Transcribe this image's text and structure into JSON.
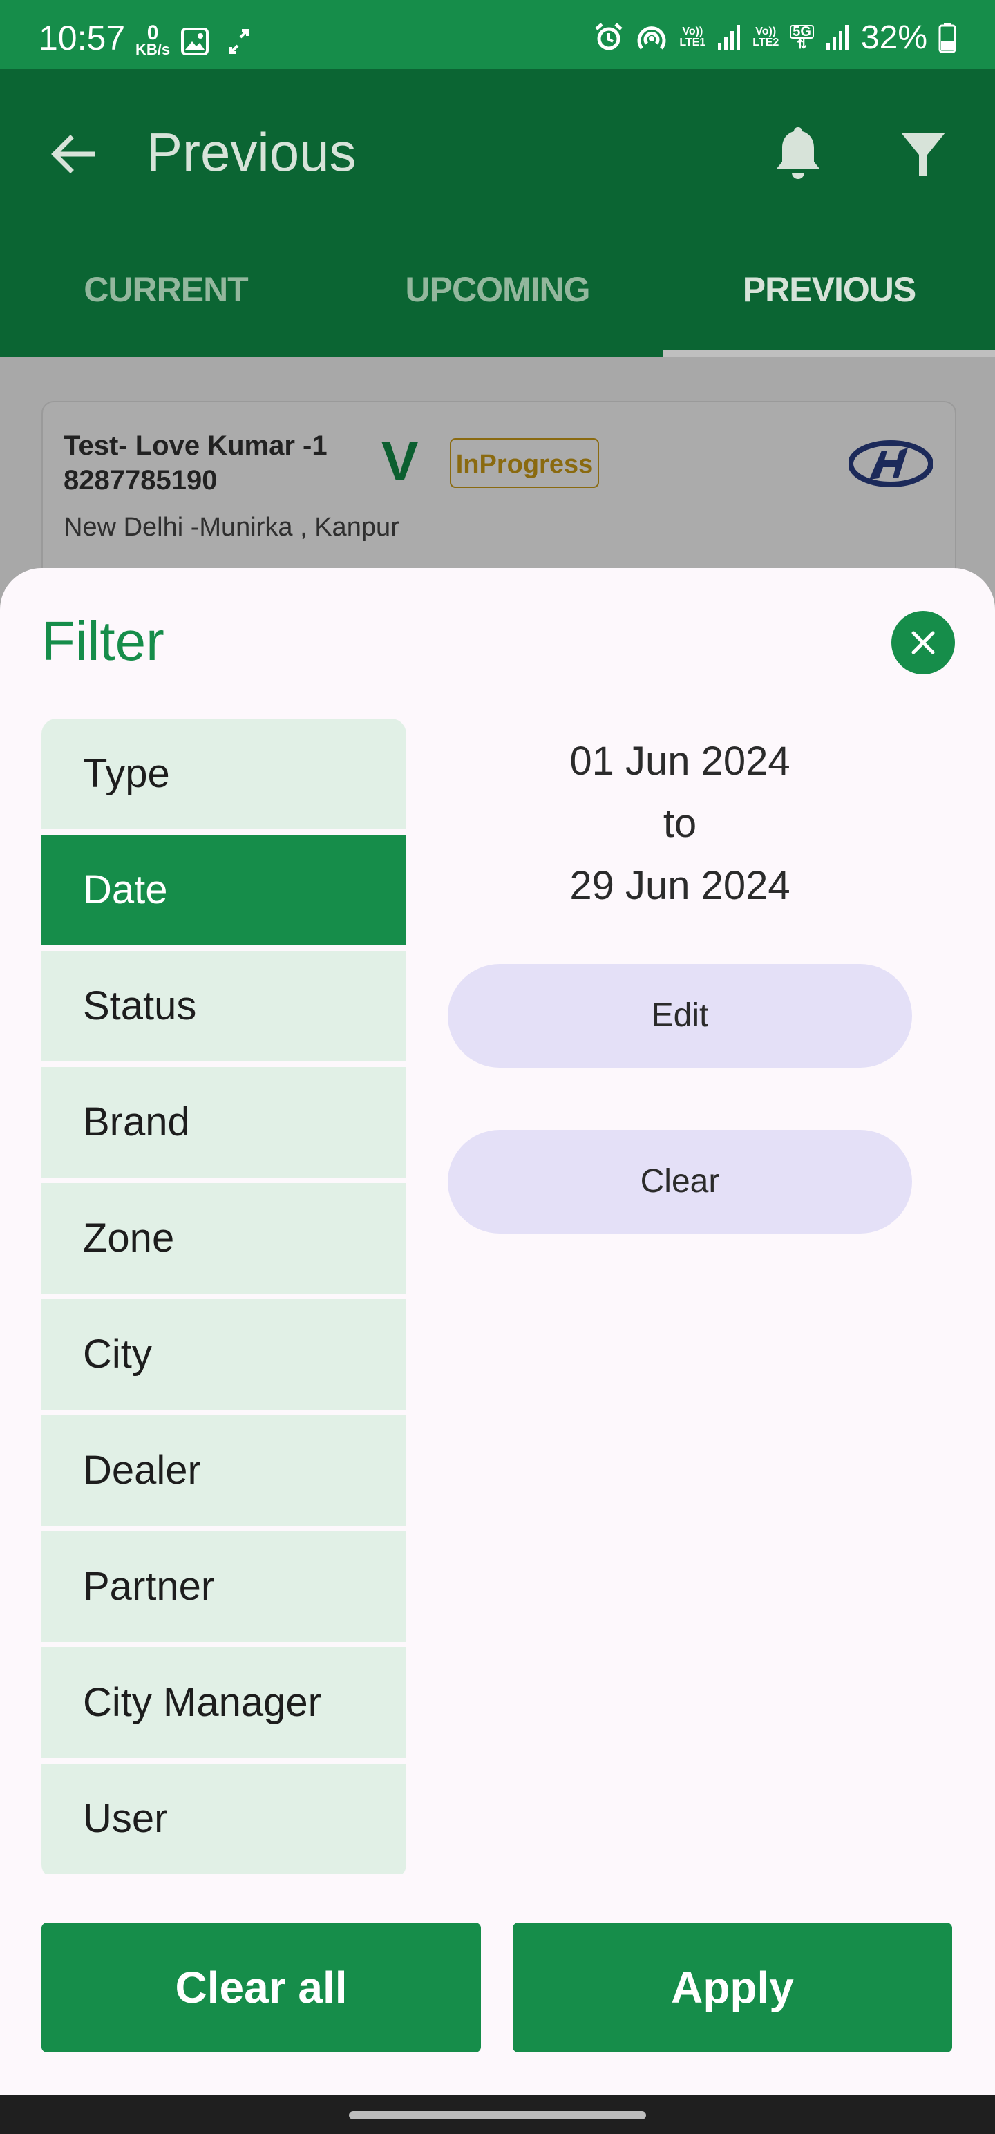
{
  "status_bar": {
    "time": "10:57",
    "data_speed_value": "0",
    "data_speed_unit": "KB/s",
    "sim1_label_top": "Vo))",
    "sim1_label_bottom": "LTE1",
    "sim2_label_top": "Vo))",
    "sim2_label_bottom": "LTE2",
    "network_type": "5G",
    "battery": "32%"
  },
  "app_bar": {
    "title": "Previous"
  },
  "tabs": [
    {
      "label": "CURRENT"
    },
    {
      "label": "UPCOMING"
    },
    {
      "label": "PREVIOUS"
    }
  ],
  "card": {
    "name": "Test- Love Kumar -1",
    "phone": "8287785190",
    "marker": "V",
    "status": "InProgress",
    "location": "New Delhi -Munirka , Kanpur"
  },
  "filter": {
    "title": "Filter",
    "menu_items": [
      {
        "label": "Type"
      },
      {
        "label": "Date"
      },
      {
        "label": "Status"
      },
      {
        "label": "Brand"
      },
      {
        "label": "Zone"
      },
      {
        "label": "City"
      },
      {
        "label": "Dealer"
      },
      {
        "label": "Partner"
      },
      {
        "label": "City Manager"
      },
      {
        "label": "User"
      }
    ],
    "selected_item": "Date",
    "date_from": "01 Jun 2024",
    "date_separator": "to",
    "date_to": "29 Jun 2024",
    "edit_label": "Edit",
    "clear_label": "Clear",
    "clear_all_label": "Clear all",
    "apply_label": "Apply"
  },
  "colors": {
    "primary_green": "#168d4a",
    "dark_green": "#0b6533",
    "menu_bg": "#e1f0e6",
    "pill_bg": "#e4e0f7",
    "badge_gold": "#8a6a10"
  }
}
